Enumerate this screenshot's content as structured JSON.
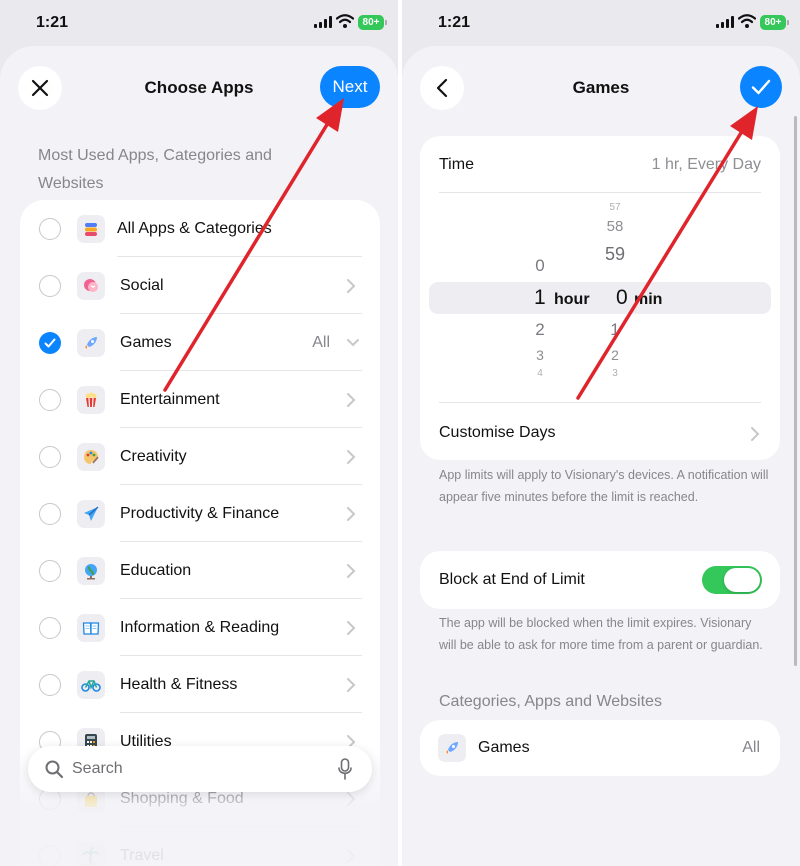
{
  "status_bar": {
    "time": "1:21",
    "battery": "80+"
  },
  "left": {
    "title": "Choose Apps",
    "next_label": "Next",
    "section_header": "Most Used Apps, Categories and Websites",
    "items": [
      {
        "label": "All Apps & Categories",
        "icon": "stack-icon",
        "checked": false
      },
      {
        "label": "Social",
        "icon": "chat-bubble-icon",
        "checked": false
      },
      {
        "label": "Games",
        "icon": "rocket-icon",
        "checked": true,
        "value": "All"
      },
      {
        "label": "Entertainment",
        "icon": "popcorn-icon",
        "checked": false
      },
      {
        "label": "Creativity",
        "icon": "palette-icon",
        "checked": false
      },
      {
        "label": "Productivity & Finance",
        "icon": "paper-plane-icon",
        "checked": false
      },
      {
        "label": "Education",
        "icon": "globe-icon",
        "checked": false
      },
      {
        "label": "Information & Reading",
        "icon": "book-icon",
        "checked": false
      },
      {
        "label": "Health & Fitness",
        "icon": "bicycle-icon",
        "checked": false
      },
      {
        "label": "Utilities",
        "icon": "calculator-icon",
        "checked": false
      },
      {
        "label": "Shopping & Food",
        "icon": "shopping-bag-icon",
        "checked": false
      },
      {
        "label": "Travel",
        "icon": "palm-tree-icon",
        "checked": false
      }
    ],
    "search": {
      "placeholder": "Search"
    }
  },
  "right": {
    "title": "Games",
    "time_label": "Time",
    "time_value": "1 hr, Every Day",
    "picker": {
      "hours_above": [
        "0"
      ],
      "hours_selected": "1",
      "hours_below": [
        "2",
        "3",
        "4"
      ],
      "hour_unit": "hour",
      "minutes_above": [
        "57",
        "58",
        "59"
      ],
      "minutes_selected": "0",
      "minutes_below": [
        "1",
        "2",
        "3"
      ],
      "minute_unit": "min"
    },
    "customise_days": "Customise Days",
    "limits_note": "App limits will apply to Visionary's devices. A notification will appear five minutes before the limit is reached.",
    "block_label": "Block at End of Limit",
    "block_enabled": true,
    "block_note": "The app will be blocked when the limit expires. Visionary will be able to ask for more time from a parent or guardian.",
    "categories_header": "Categories, Apps and Websites",
    "selected_category": {
      "label": "Games",
      "value": "All"
    }
  },
  "colors": {
    "accent": "#0a84ff",
    "toggle_on": "#34c759",
    "annotation_arrow": "#e0242c"
  }
}
